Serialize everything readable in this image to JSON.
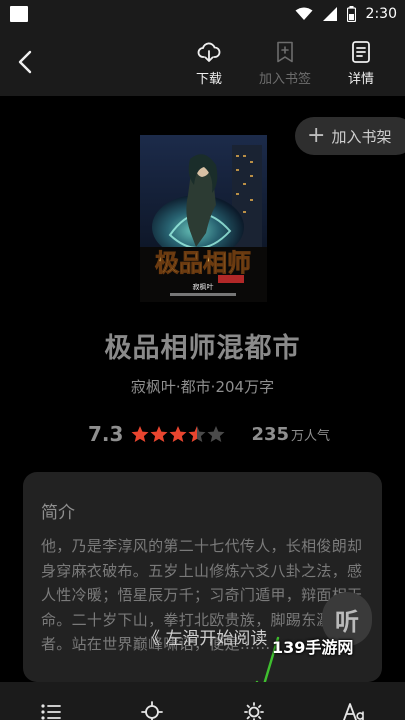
{
  "status_bar": {
    "time": "2:30"
  },
  "toolbar": {
    "back_icon": "chevron-left-icon",
    "actions": [
      {
        "label": "下载",
        "icon": "cloud-download-icon",
        "enabled": true
      },
      {
        "label": "加入书签",
        "icon": "bookmark-add-icon",
        "enabled": false
      },
      {
        "label": "详情",
        "icon": "document-icon",
        "enabled": true
      }
    ]
  },
  "shelf_button": {
    "label": "加入书架"
  },
  "book": {
    "title": "极品相师混都市",
    "meta": "寂枫叶·都市·204万字",
    "score": "7.3",
    "stars_filled": 3.5,
    "stars_total": 5,
    "popularity_value": "235",
    "popularity_unit": "万人气",
    "cover": {
      "title_art": "极品相师",
      "author_art": "寂枫叶"
    }
  },
  "intro": {
    "title": "简介",
    "text": "他，乃是李淳风的第二十七代传人，长相俊朗却身穿麻衣破布。五岁上山修炼六爻八卦之法，感人性冷暖；悟星辰万千；习奇门遁甲，辩面相天命。二十岁下山，拳打北欧贵族，脚踢东瀛忍者。站在世界巅峰啸话，便是……"
  },
  "listen_button": {
    "label": "听"
  },
  "swipe_hint": "《 左滑开始阅读",
  "watermark": "139手游网",
  "colors": {
    "background": "#000000",
    "bar": "#1b1b1b",
    "card": "#222222",
    "star_active": "#e8452f",
    "star_inactive": "#4a4a4a",
    "arrow": "#3fbf2f"
  },
  "bottom_bar": {
    "icons": [
      "list-icon",
      "progress-icon",
      "brightness-icon",
      "font-size-icon"
    ]
  }
}
